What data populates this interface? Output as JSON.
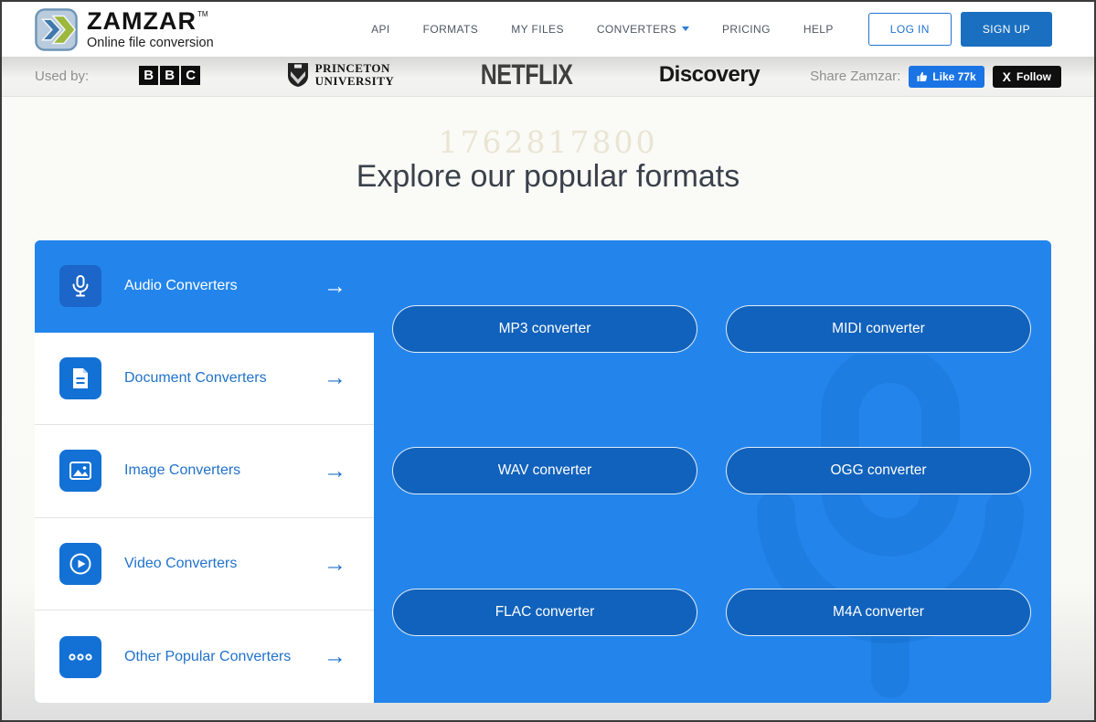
{
  "brand": {
    "name": "ZAMZAR",
    "tm": "TM",
    "tagline": "Online file conversion"
  },
  "nav": {
    "items": [
      {
        "label": "API"
      },
      {
        "label": "FORMATS"
      },
      {
        "label": "MY FILES"
      },
      {
        "label": "CONVERTERS"
      },
      {
        "label": "PRICING"
      },
      {
        "label": "HELP"
      }
    ],
    "login_label": "LOG IN",
    "signup_label": "SIGN UP"
  },
  "trustbar": {
    "used_by_label": "Used by:",
    "bbc_letters": [
      "B",
      "B",
      "C"
    ],
    "princeton_line1": "PRINCETON",
    "princeton_line2": "UNIVERSITY",
    "netflix": "NETFLIX",
    "discovery": "Discovery",
    "share_label": "Share Zamzar:",
    "like_label": "Like 77k",
    "follow_x": "X",
    "follow_label": "Follow"
  },
  "main": {
    "counter": "1762817800",
    "heading": "Explore our popular formats"
  },
  "categories": [
    {
      "label": "Audio Converters",
      "icon": "microphone-icon",
      "active": true
    },
    {
      "label": "Document Converters",
      "icon": "document-icon",
      "active": false
    },
    {
      "label": "Image Converters",
      "icon": "image-icon",
      "active": false
    },
    {
      "label": "Video Converters",
      "icon": "video-play-icon",
      "active": false
    },
    {
      "label": "Other Popular Converters",
      "icon": "ellipsis-icon",
      "active": false
    }
  ],
  "category_arrow": "→",
  "converters": [
    "MP3 converter",
    "MIDI converter",
    "WAV converter",
    "OGG converter",
    "FLAC converter",
    "M4A converter"
  ],
  "colors": {
    "panel_blue": "#2385ec",
    "button_blue": "#1162bc",
    "tile_blue": "#1371d6",
    "accent_blue": "#2073cf",
    "signup_blue": "#1a6fc0",
    "facebook_blue": "#1b74e4",
    "follow_black": "#0f0f0f"
  }
}
